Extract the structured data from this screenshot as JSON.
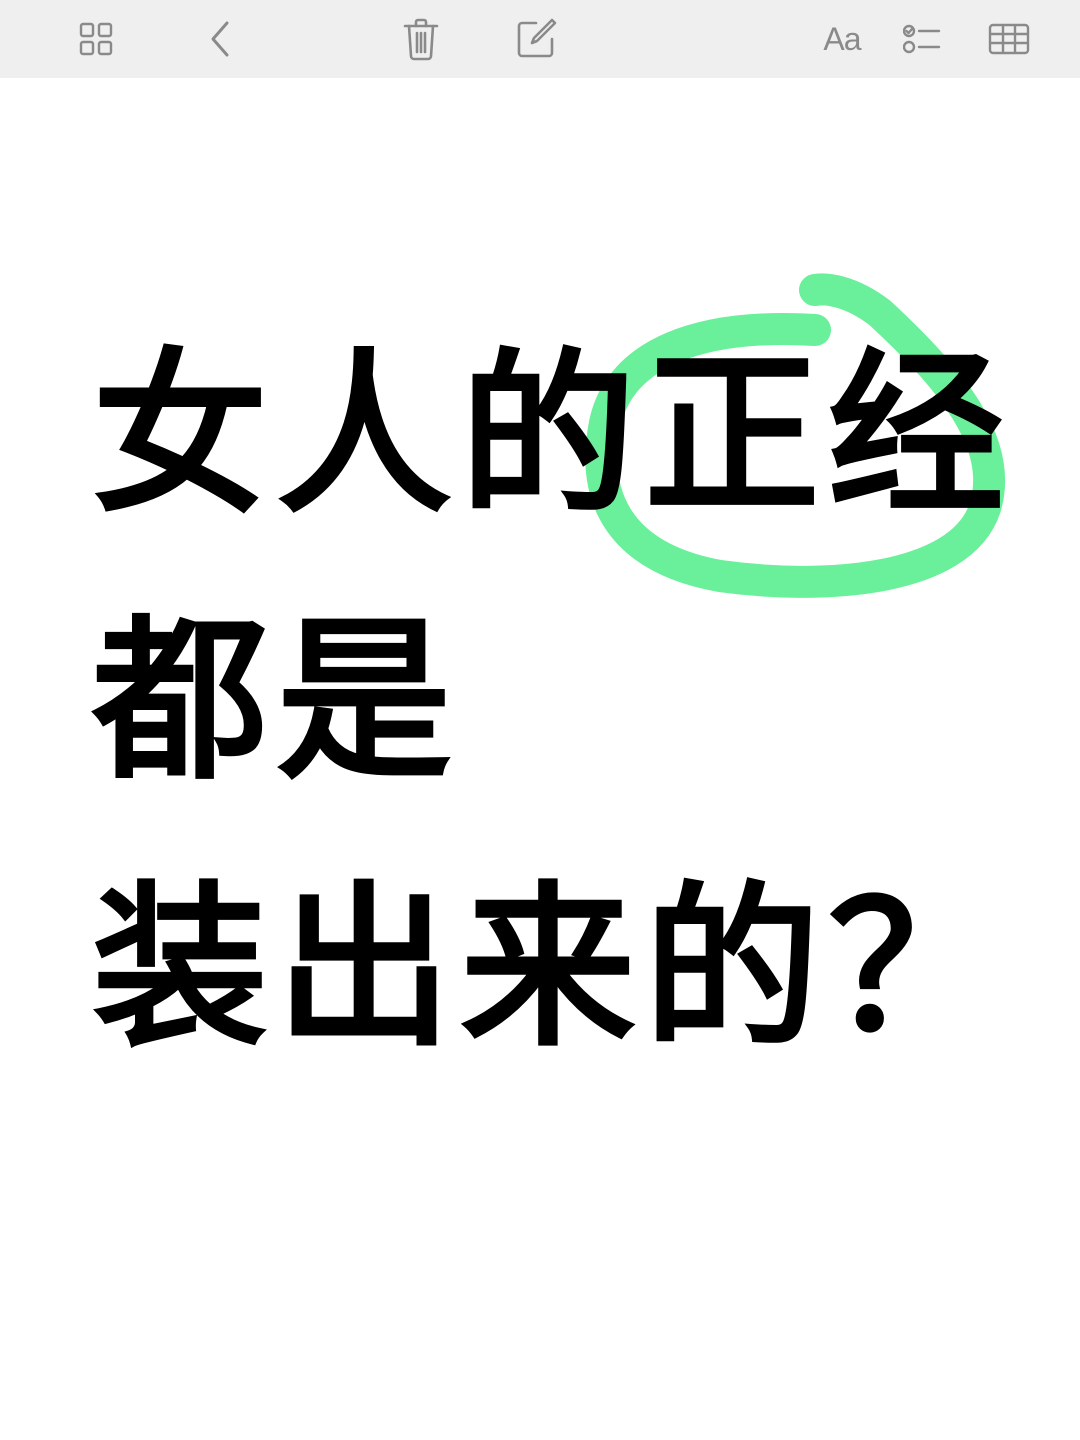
{
  "toolbar": {
    "buttons": [
      {
        "name": "gallery-view-button",
        "icon": "grid-icon"
      },
      {
        "name": "back-button",
        "icon": "chevron-left-icon"
      },
      {
        "name": "delete-button",
        "icon": "trash-icon"
      },
      {
        "name": "compose-button",
        "icon": "compose-icon"
      },
      {
        "name": "format-button",
        "icon": "text-format-icon",
        "label": "Aa"
      },
      {
        "name": "checklist-button",
        "icon": "checklist-icon"
      },
      {
        "name": "table-button",
        "icon": "table-icon"
      }
    ],
    "icon_color": "#8a8a8a",
    "background": "#efefef"
  },
  "note": {
    "lines": [
      "女人的正经",
      "都是",
      "装出来的？"
    ],
    "highlight_color": "#6af09a",
    "highlight_target": "正经"
  }
}
